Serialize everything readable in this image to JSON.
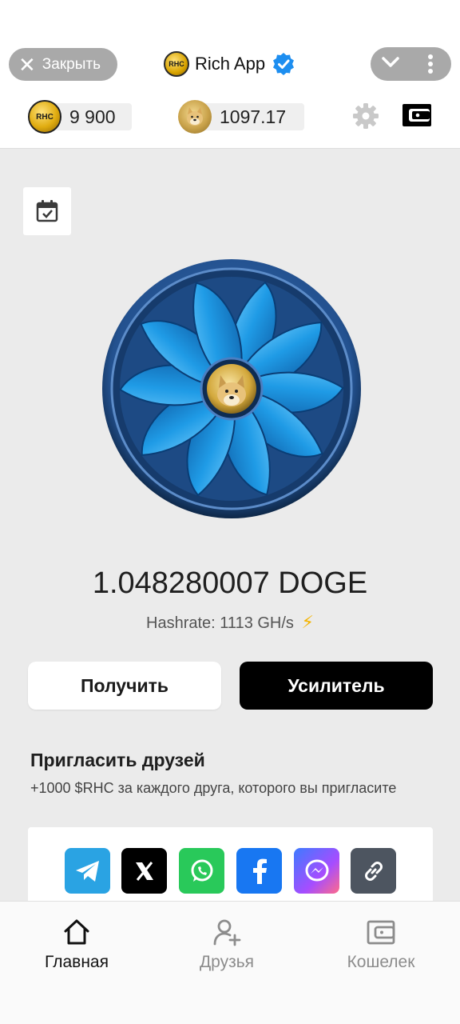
{
  "header": {
    "close_label": "Закрыть",
    "app_name": "Rich App",
    "app_logo_text": "RHC"
  },
  "balances": {
    "rhc": {
      "coin": "RHC",
      "value": "9 900"
    },
    "doge": {
      "value": "1097.17"
    }
  },
  "mining": {
    "amount": "1.048280007 DOGE",
    "hashrate": "Hashrate: 1113 GH/s",
    "hashrate_icon": "⚡"
  },
  "actions": {
    "claim_label": "Получить",
    "boost_label": "Усилитель"
  },
  "invite": {
    "title": "Пригласить друзей",
    "subtitle": "+1000 $RHC за каждого друга, которого вы пригласите",
    "share_targets": [
      "telegram",
      "x",
      "whatsapp",
      "facebook",
      "messenger",
      "copy-link"
    ]
  },
  "nav": {
    "items": [
      {
        "label": "Главная",
        "icon": "home-icon",
        "active": true
      },
      {
        "label": "Друзья",
        "icon": "add-friend-icon",
        "active": false
      },
      {
        "label": "Кошелек",
        "icon": "wallet-icon",
        "active": false
      }
    ]
  },
  "colors": {
    "accent_black": "#000000",
    "verified_blue": "#1d8ef0",
    "telegram": "#2aa3e3",
    "x": "#000000",
    "whatsapp": "#29c95a",
    "facebook": "#1877f2",
    "messenger": "#8a5cf6",
    "link": "#4d5560",
    "inactive_nav": "#8c8c8c"
  }
}
